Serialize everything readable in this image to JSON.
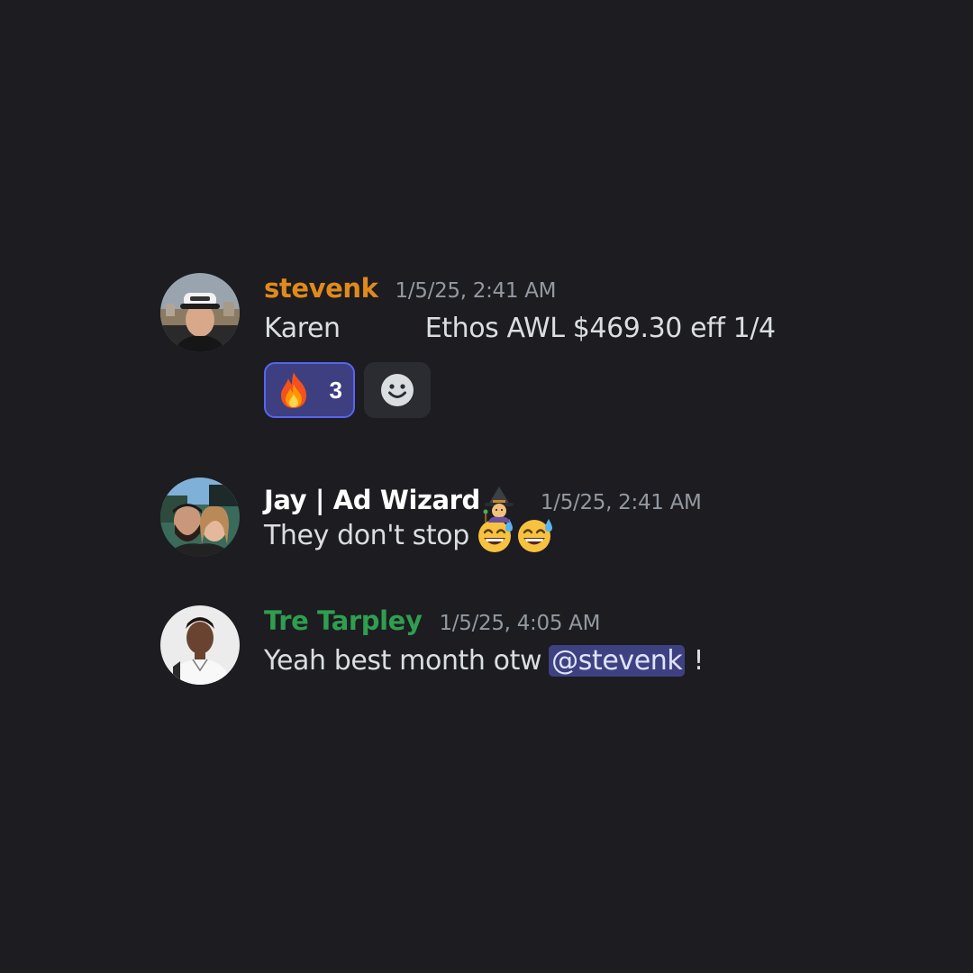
{
  "messages": [
    {
      "author": "stevenk",
      "author_color": "#e08a1e",
      "timestamp": "1/5/25, 2:41 AM",
      "text_left": "Karen",
      "text_right": "Ethos AWL $469.30 eff 1/4",
      "reactions": [
        {
          "emoji": "fire-icon",
          "count": "3",
          "active": true
        }
      ],
      "add_reaction_icon": "smiley-icon"
    },
    {
      "author": "Jay | Ad Wizard",
      "author_badge_icon": "wizard-emoji-icon",
      "author_color": "#ffffff",
      "timestamp": "1/5/25, 2:41 AM",
      "text": "They don't stop",
      "trailing_emojis": [
        "sweat-smile-emoji-icon",
        "sweat-smile-emoji-icon"
      ]
    },
    {
      "author": "Tre Tarpley",
      "author_color": "#2f9e4f",
      "timestamp": "1/5/25, 4:05 AM",
      "text": "Yeah best month otw",
      "mention": "@stevenk",
      "text_after": " !"
    }
  ],
  "colors": {
    "background": "#1c1c21",
    "timestamp": "#9499a1",
    "mention_bg": "#3e4181",
    "reaction_active_bg": "#3d3f80",
    "reaction_active_border": "#5865f2"
  }
}
